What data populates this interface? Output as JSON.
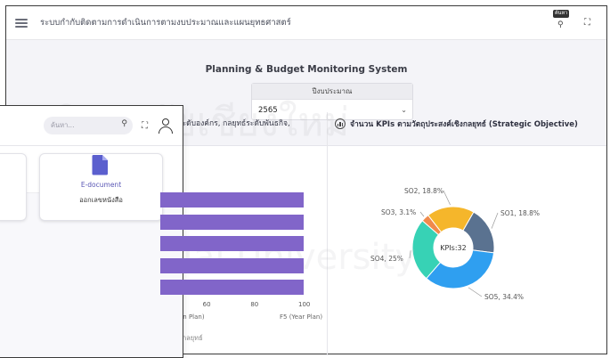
{
  "back_window": {
    "title": "ระบบกำกับติดตามการดำเนินการตามงบประมาณและแผนยุทธศาสตร์",
    "search_tag": "ค้นหา",
    "system_title": "Planning & Budget Monitoring System",
    "year_label": "ปีงบประมาณ",
    "year_value": "2565",
    "left_chart_title_fragment": "ระดับองค์กร, กลยุทธ์ระดับพันธกิจ,",
    "left_chart_hint": "ลกลยุทธ์"
  },
  "watermark": {
    "text_th": "หาวิทยาลัยเชียงใหม่",
    "text_en": "Chiang Mai University"
  },
  "front_window": {
    "search_placeholder": "ค้นหา...",
    "edoc_title": "E-document",
    "edoc_subtitle": "ออกเลขหนังสือ"
  },
  "colors": {
    "bar": "#8165c9",
    "so1": "#5a7290",
    "so2": "#f5b62b",
    "so3": "#f08a4b",
    "so4": "#37d2b5",
    "so5": "#2f9ff0"
  },
  "chart_data": [
    {
      "type": "bar",
      "orientation": "horizontal",
      "title": "ระดับองค์กร, กลยุทธ์ระดับพันธกิจ,",
      "x_ticks": [
        "60",
        "80",
        "100"
      ],
      "x_sub_labels": [
        "on Plan)",
        "F5 (Year Plan)"
      ],
      "xlim": [
        40,
        100
      ],
      "values": [
        100,
        100,
        100,
        100,
        100
      ]
    },
    {
      "type": "pie",
      "donut": true,
      "title": "จำนวน KPIs ตามวัตถุประสงค์เชิงกลยุทธ์ (Strategic Objective)",
      "center_label": "KPIs:32",
      "slices": [
        {
          "name": "SO1",
          "label": "SO1, 18.8%",
          "value": 18.8
        },
        {
          "name": "SO5",
          "label": "SO5, 34.4%",
          "value": 34.4
        },
        {
          "name": "SO4",
          "label": "SO4, 25%",
          "value": 25.0
        },
        {
          "name": "SO3",
          "label": "SO3, 3.1%",
          "value": 3.1
        },
        {
          "name": "SO2",
          "label": "SO2, 18.8%",
          "value": 18.8
        }
      ]
    }
  ]
}
